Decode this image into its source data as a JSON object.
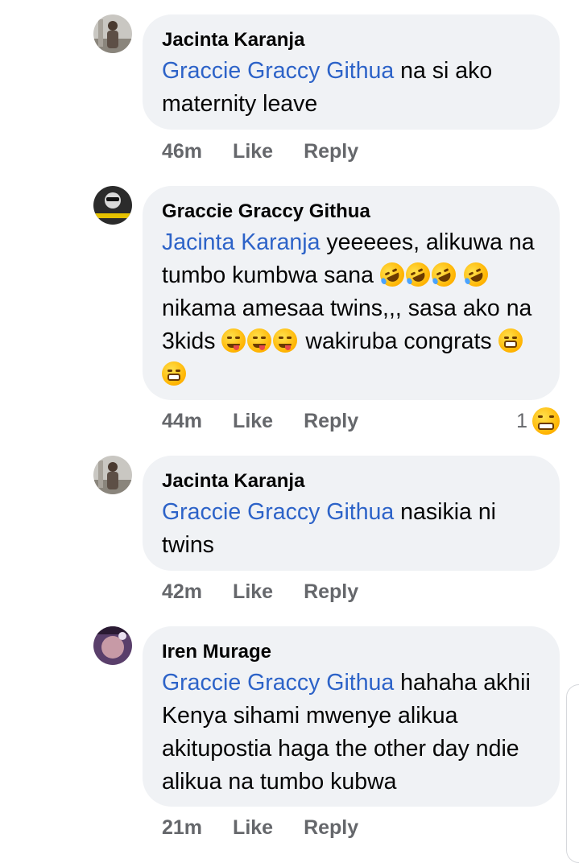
{
  "comments": [
    {
      "author": "Jacinta Karanja",
      "mention": "Graccie Graccy Githua",
      "text": " na si ako maternity leave",
      "time": "46m",
      "like": "Like",
      "reply": "Reply"
    },
    {
      "author": "Graccie Graccy Githua",
      "mention": "Jacinta Karanja",
      "text1": " yeeeees, alikuwa na tumbo kumbwa sana ",
      "text2": " nikama amesaa twins,,, sasa ako na 3kids ",
      "text3": " wakiruba congrats ",
      "time": "44m",
      "like": "Like",
      "reply": "Reply",
      "reaction_count": "1",
      "reaction_icon": "laughing-emoji-icon"
    },
    {
      "author": "Jacinta Karanja",
      "mention": "Graccie Graccy Githua",
      "text": " nasikia ni twins",
      "time": "42m",
      "like": "Like",
      "reply": "Reply"
    },
    {
      "author": "Iren Murage",
      "mention": "Graccie Graccy Githua",
      "text": " hahaha akhii Kenya sihami mwenye alikua akitupostia haga the other day ndie alikua na tumbo kubwa",
      "time": "21m",
      "like": "Like",
      "reply": "Reply"
    }
  ],
  "colors": {
    "bubble": "#f0f2f5",
    "mention": "#2d63c8",
    "meta": "#65676b"
  }
}
